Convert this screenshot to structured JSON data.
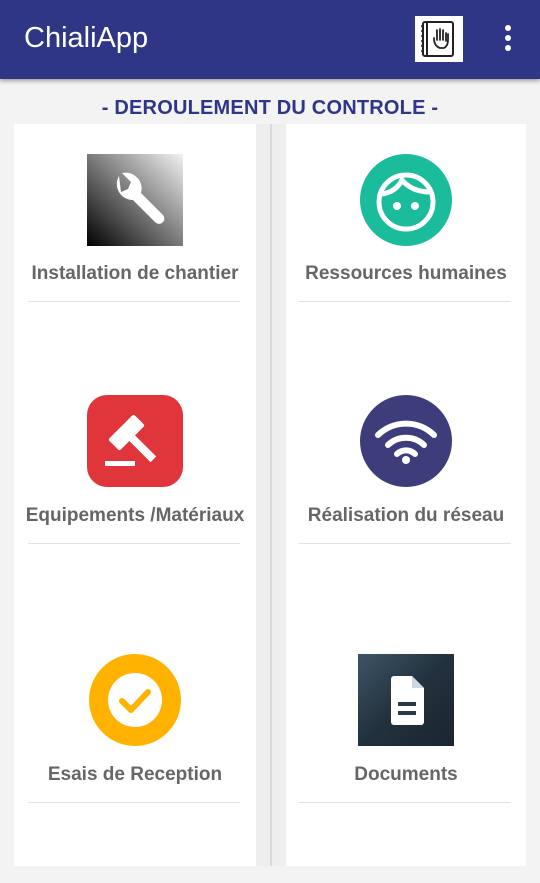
{
  "app": {
    "title": "ChialiApp",
    "toolbar_icons": [
      "manual-book-hand-icon",
      "overflow-menu-icon"
    ],
    "colors": {
      "primary": "#2f3686",
      "label": "#666666"
    }
  },
  "heading": "- DEROULEMENT DU CONTROLE -",
  "tiles": [
    {
      "label": "Installation de chantier",
      "icon": "wrench-icon"
    },
    {
      "label": "Ressources humaines",
      "icon": "face-icon"
    },
    {
      "label": "Equipements /Matériaux",
      "icon": "gavel-icon"
    },
    {
      "label": "Réalisation du réseau",
      "icon": "wifi-icon"
    },
    {
      "label": "Esais de Reception",
      "icon": "check-circle-icon"
    },
    {
      "label": "Documents",
      "icon": "document-icon"
    }
  ]
}
